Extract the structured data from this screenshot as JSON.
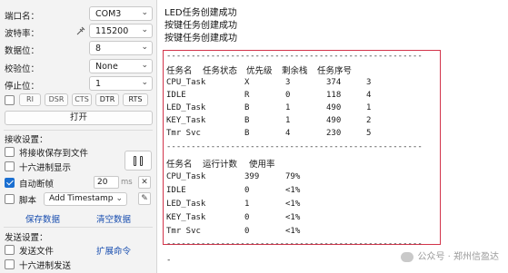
{
  "serial": {
    "port_label": "端口名：",
    "port_value": "COM3",
    "baud_label": "波特率：",
    "baud_value": "115200",
    "databits_label": "数据位：",
    "databits_value": "8",
    "parity_label": "校验位：",
    "parity_value": "None",
    "stopbits_label": "停止位：",
    "stopbits_value": "1",
    "signals": [
      "RI",
      "DSR",
      "CTS",
      "DTR",
      "RTS"
    ],
    "open_label": "打开"
  },
  "receive": {
    "title": "接收设置：",
    "save_to_file": "将接收保存到文件",
    "hex_display": "十六进制显示",
    "auto_frame": "自动断帧",
    "auto_frame_ms": "20",
    "ms_unit": "ms",
    "script": "脚本",
    "timestamp_option": "Add Timestamp",
    "save_data": "保存数据",
    "clear_data": "清空数据"
  },
  "send": {
    "title": "发送设置：",
    "send_file": "发送文件",
    "expand_cmd": "扩展命令",
    "hex_send": "十六进制发送"
  },
  "terminal": {
    "lines_top": [
      "LED任务创建成功",
      "按键任务创建成功",
      "按键任务创建成功"
    ],
    "separator": "----------------------------------------------------",
    "table1_header": [
      "任务名",
      "任务状态",
      "优先级",
      "剩余栈",
      "任务序号"
    ],
    "table1_rows": [
      [
        "CPU_Task",
        "X",
        "3",
        "374",
        "3"
      ],
      [
        "IDLE",
        "R",
        "0",
        "118",
        "4"
      ],
      [
        "LED_Task",
        "B",
        "1",
        "490",
        "1"
      ],
      [
        "KEY_Task",
        "B",
        "1",
        "490",
        "2"
      ],
      [
        "Tmr Svc",
        "B",
        "4",
        "230",
        "5"
      ]
    ],
    "table2_header": [
      "任务名",
      "运行计数",
      "使用率"
    ],
    "table2_rows": [
      [
        "CPU_Task",
        "399",
        "79%"
      ],
      [
        "IDLE",
        "0",
        "<1%"
      ],
      [
        "LED_Task",
        "1",
        "<1%"
      ],
      [
        "KEY_Task",
        "0",
        "<1%"
      ],
      [
        "Tmr Svc",
        "0",
        "<1%"
      ]
    ],
    "trailing": "-"
  },
  "watermark": "公众号 · 郑州信盈达",
  "colors": {
    "highlight_border": "#d2344a",
    "checkbox_on": "#1a6fd1",
    "link": "#1a4fb0"
  }
}
